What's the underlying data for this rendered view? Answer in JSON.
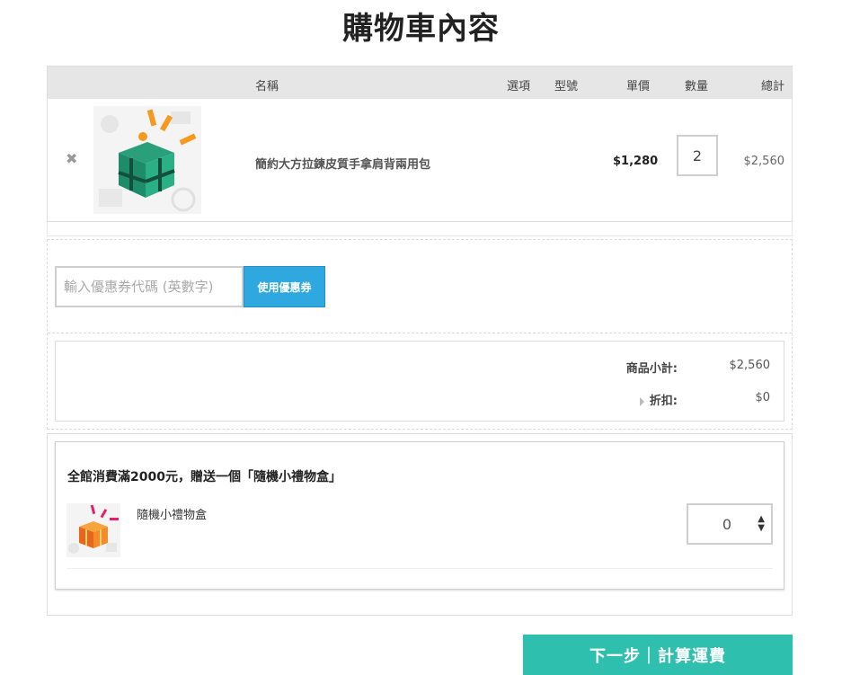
{
  "page": {
    "title": "購物車內容"
  },
  "table": {
    "headers": {
      "name": "名稱",
      "option": "選項",
      "model": "型號",
      "price": "單價",
      "qty": "數量",
      "total": "總計"
    },
    "rows": [
      {
        "name": "簡約大方拉鍊皮質手拿肩背兩用包",
        "price": "$1,280",
        "qty": "2",
        "total": "$2,560",
        "remove": "✖"
      }
    ]
  },
  "coupon": {
    "placeholder": "輸入優惠券代碼 (英數字)",
    "button_label": "使用優惠券"
  },
  "summary": {
    "subtotal_label": "商品小計:",
    "subtotal_value": "$2,560",
    "discount_label": "折扣:",
    "discount_value": "$0"
  },
  "promo": {
    "title": "全館消費滿2000元，贈送一個「隨機小禮物盒」",
    "gift_name": "隨機小禮物盒",
    "gift_qty": "0"
  },
  "next_button": {
    "label": "下一步｜計算運費"
  },
  "colors": {
    "coupon_button": "#2ea8df",
    "next_button": "#2fbfae",
    "header_bg": "#e6e6e6"
  }
}
